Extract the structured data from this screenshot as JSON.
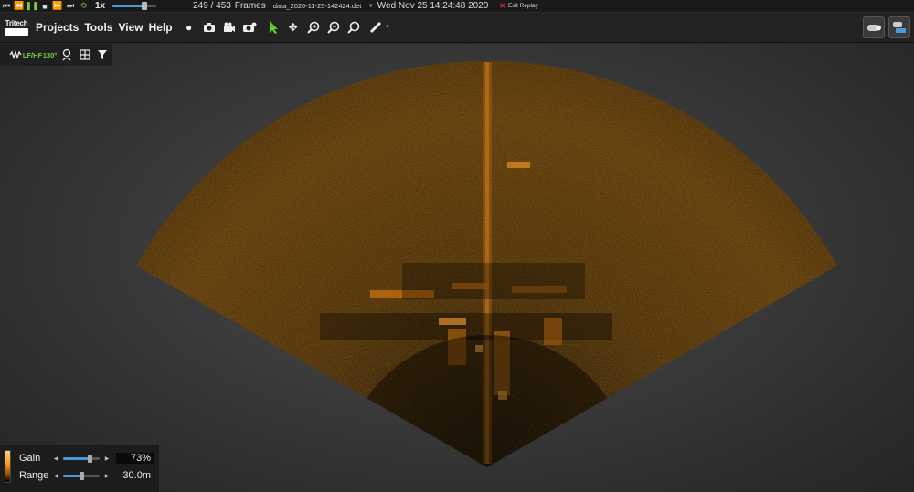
{
  "replay": {
    "speed": "1x",
    "scrub_fraction": 0.7,
    "current_frame": "249",
    "frames_sep": " / ",
    "total_frames": "453",
    "frames_label": "Frames",
    "file_name": "data_2020-11-25-142424.det",
    "datetime": "Wed Nov 25 14:24:48 2020",
    "exit_label": "Exit Replay"
  },
  "logo": {
    "text": "Tritech"
  },
  "menu": {
    "projects": "Projects",
    "tools": "Tools",
    "view": "View",
    "help": "Help"
  },
  "subbar": {
    "lf_hf": "LF/HF",
    "angle": "130°"
  },
  "panel": {
    "gain_label": "Gain",
    "gain_value": "73%",
    "gain_fraction": 0.73,
    "range_label": "Range",
    "range_value": "30.0m",
    "range_fraction": 0.5
  },
  "colors": {
    "accent_blue": "#4a9ad8",
    "play_green": "#7fcf3f",
    "pointer_green": "#5ccf2a",
    "exit_red": "#e03030",
    "sonar_orange": "#c87010"
  }
}
